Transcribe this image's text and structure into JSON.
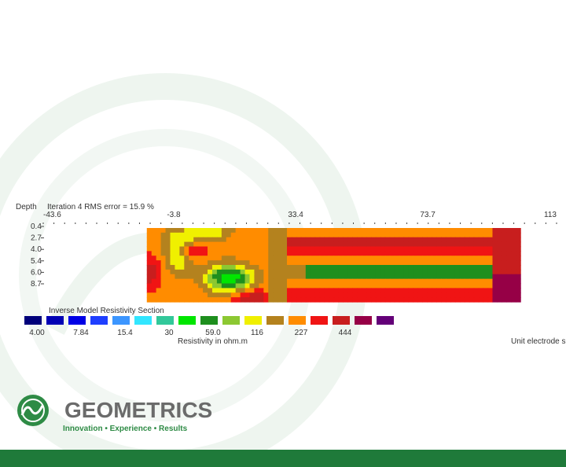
{
  "slide": {
    "company": "GEOMETRICS",
    "tagline": "Innovation • Experience • Results",
    "colors": {
      "brand_green": "#1f7a3a",
      "logo_gray": "#6b6b6b",
      "watermark": "#eef5ef"
    }
  },
  "chart_data": {
    "type": "heatmap",
    "title": "Iteration 4 RMS error = 15.9 %",
    "depth_label": "Depth",
    "section_title": "Inverse Model Resistivity Section",
    "x_ticks": [
      "-43.6",
      "-3.8",
      "33.4",
      "73.7",
      "113"
    ],
    "x_range": [
      -43.6,
      113
    ],
    "data_x_range": [
      -12,
      102
    ],
    "depth_ticks": [
      "0.4",
      "2.7",
      "4.0",
      "5.4",
      "6.0",
      "8.7"
    ],
    "color_scale": {
      "colors": [
        "#00007a",
        "#0000b4",
        "#0000e6",
        "#1f3fff",
        "#3c96ff",
        "#32e6ff",
        "#32c89a",
        "#00e600",
        "#1e8f1e",
        "#8cc832",
        "#f0f000",
        "#b4821e",
        "#ff8c00",
        "#f01414",
        "#c81e1e",
        "#960046",
        "#640078"
      ],
      "labels": [
        "4.00",
        "7.84",
        "15.4",
        "30",
        "59.0",
        "116",
        "227",
        "444"
      ],
      "label_slots": [
        0,
        2,
        4,
        6,
        8,
        10,
        12,
        14
      ]
    },
    "resistivity_label": "Resistivity in ohm.m",
    "electrode_label": "Unit electrode sp",
    "grid": false,
    "legend_placement": "bottom"
  }
}
